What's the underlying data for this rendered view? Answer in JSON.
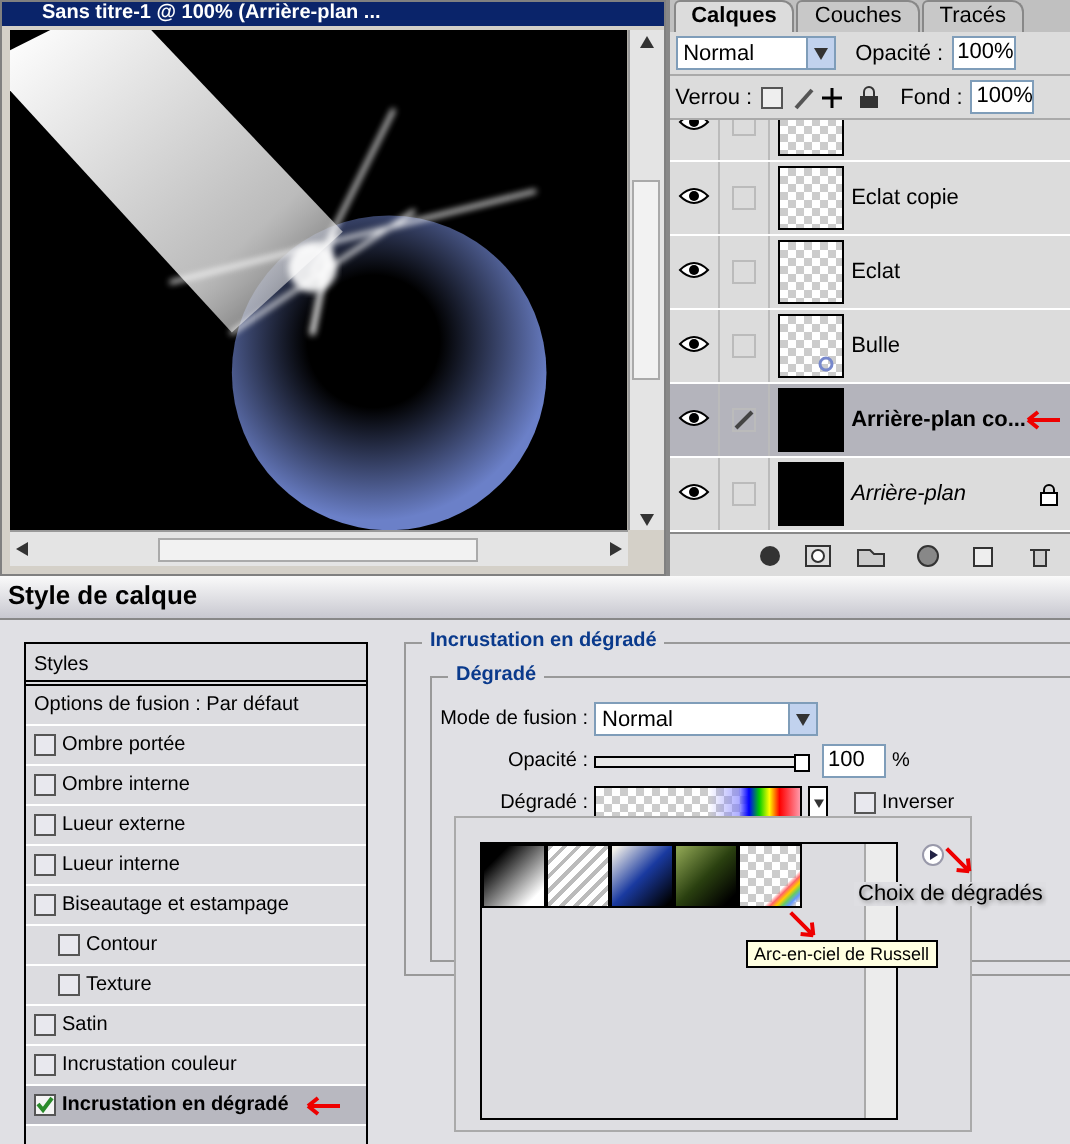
{
  "document": {
    "title": "Sans titre-1 @ 100% (Arrière-plan ..."
  },
  "layers_panel": {
    "tabs": [
      {
        "label": "Calques",
        "selected": true
      },
      {
        "label": "Couches",
        "selected": false
      },
      {
        "label": "Tracés",
        "selected": false
      }
    ],
    "blend_mode": "Normal",
    "opacity_label": "Opacité :",
    "opacity": "100%",
    "lock_label": "Verrou :",
    "fill_label": "Fond :",
    "fill": "100%",
    "layers": [
      {
        "kind": "transparent",
        "visible": true,
        "selected": false
      },
      {
        "name": "Eclat copie",
        "kind": "transparent",
        "visible": true,
        "selected": false
      },
      {
        "name": "Eclat",
        "kind": "transparent",
        "visible": true,
        "selected": false
      },
      {
        "name": "Bulle",
        "kind": "bubble",
        "visible": true,
        "selected": false
      },
      {
        "name": "Arrière-plan co...",
        "kind": "black",
        "visible": true,
        "selected": true,
        "annotated": true
      },
      {
        "name": "Arrière-plan",
        "kind": "background",
        "visible": true,
        "selected": false,
        "locked": true
      }
    ]
  },
  "dialog": {
    "title": "Style de calque",
    "styles_header": "Styles",
    "blending_options": "Options de fusion : Par défaut",
    "effects": [
      {
        "label": "Ombre portée",
        "checked": false,
        "selected": false
      },
      {
        "label": "Ombre interne",
        "checked": false,
        "selected": false
      },
      {
        "label": "Lueur externe",
        "checked": false,
        "selected": false
      },
      {
        "label": "Lueur interne",
        "checked": false,
        "selected": false
      },
      {
        "label": "Biseautage et estampage",
        "checked": false,
        "selected": false,
        "children": [
          {
            "label": "Contour",
            "checked": false,
            "selected": false
          },
          {
            "label": "Texture",
            "checked": false,
            "selected": false
          }
        ]
      },
      {
        "label": "Satin",
        "checked": false,
        "selected": false
      },
      {
        "label": "Incrustation couleur",
        "checked": false,
        "selected": false
      },
      {
        "label": "Incrustation en dégradé",
        "checked": true,
        "selected": true,
        "annotated": true
      }
    ],
    "section_title": "Incrustation en dégradé",
    "group_title": "Dégradé",
    "blend_mode_label": "Mode de fusion :",
    "blend_mode": "Normal",
    "opacity_label": "Opacité :",
    "opacity": {
      "level": 1,
      "value": "100",
      "unit": "%"
    },
    "gradient_label": "Dégradé :",
    "reverse": {
      "label": "Inverser",
      "checked": false
    },
    "picker": {
      "swatches": [
        {
          "kind": "black-white"
        },
        {
          "kind": "stripes"
        },
        {
          "kind": "blue"
        },
        {
          "kind": "green"
        },
        {
          "kind": "rainbow"
        }
      ],
      "menu_label": "Choix de dégradés",
      "tooltip": "Arc-en-ciel de Russell"
    }
  }
}
